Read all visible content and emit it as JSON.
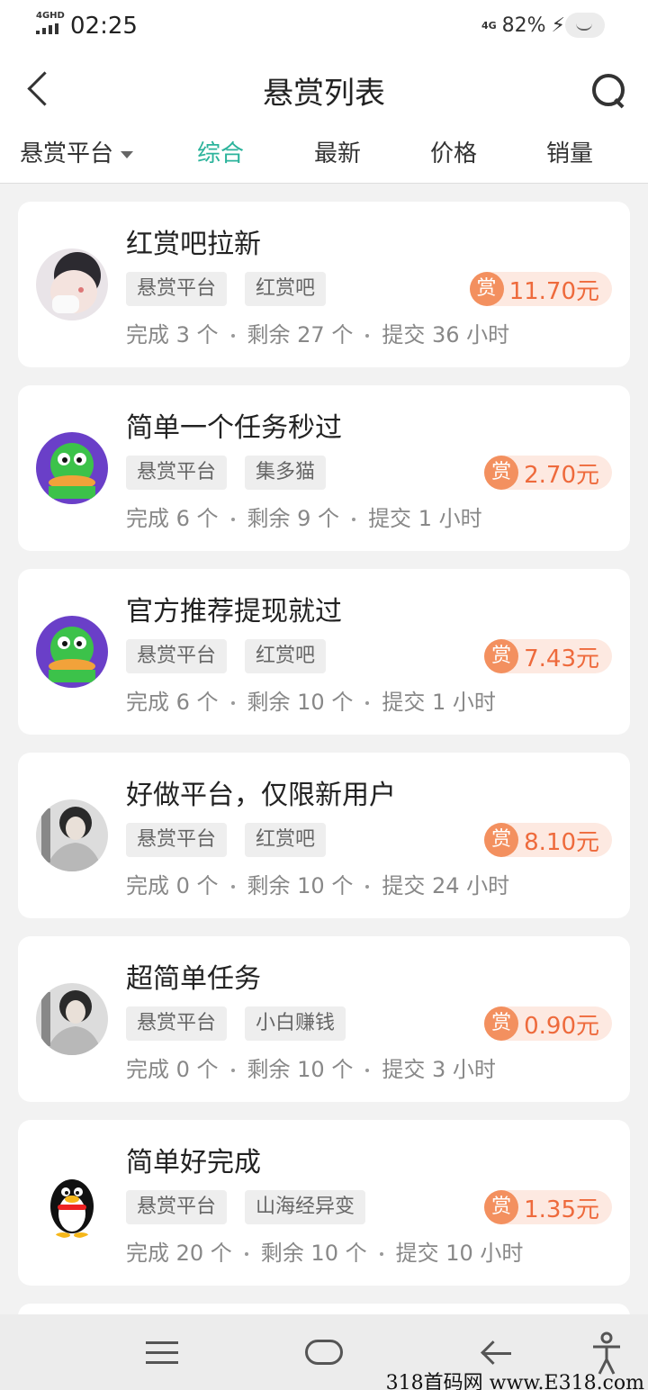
{
  "status_bar": {
    "network": "4GHD",
    "time": "02:25",
    "mobile_data": "4G",
    "battery": "82%"
  },
  "header": {
    "title": "悬赏列表",
    "icons": [
      "back-arrow-icon",
      "search-icon"
    ]
  },
  "filter_tabs": {
    "dropdown_label": "悬赏平台",
    "tabs": [
      "综合",
      "最新",
      "价格",
      "销量"
    ],
    "active_tab": "综合",
    "active_color": "#2bb39b"
  },
  "accent": {
    "reward_badge": "#f3905f",
    "reward_text": "#ee6a3c",
    "reward_bg": "#fde9e1"
  },
  "tasks": [
    {
      "title": "红赏吧拉新",
      "tags": [
        "悬赏平台",
        "红赏吧"
      ],
      "reward_badge": "赏",
      "price": "11.70元",
      "completed": "完成 3 个",
      "remaining": "剩余 27 个",
      "submit": "提交 36 小时",
      "avatar": "girl-photo"
    },
    {
      "title": "简单一个任务秒过",
      "tags": [
        "悬赏平台",
        "集多猫"
      ],
      "reward_badge": "赏",
      "price": "2.70元",
      "completed": "完成 6 个",
      "remaining": "剩余 9 个",
      "submit": "提交 1 小时",
      "avatar": "green-duck"
    },
    {
      "title": "官方推荐提现就过",
      "tags": [
        "悬赏平台",
        "红赏吧"
      ],
      "reward_badge": "赏",
      "price": "7.43元",
      "completed": "完成 6 个",
      "remaining": "剩余 10 个",
      "submit": "提交 1 小时",
      "avatar": "green-duck"
    },
    {
      "title": "好做平台，仅限新用户",
      "tags": [
        "悬赏平台",
        "红赏吧"
      ],
      "reward_badge": "赏",
      "price": "8.10元",
      "completed": "完成 0 个",
      "remaining": "剩余 10 个",
      "submit": "提交 24 小时",
      "avatar": "man-photo"
    },
    {
      "title": "超简单任务",
      "tags": [
        "悬赏平台",
        "小白赚钱"
      ],
      "reward_badge": "赏",
      "price": "0.90元",
      "completed": "完成 0 个",
      "remaining": "剩余 10 个",
      "submit": "提交 3 小时",
      "avatar": "man-photo"
    },
    {
      "title": "简单好完成",
      "tags": [
        "悬赏平台",
        "山海经异变"
      ],
      "reward_badge": "赏",
      "price": "1.35元",
      "completed": "完成 20 个",
      "remaining": "剩余 10 个",
      "submit": "提交 10 小时",
      "avatar": "qq-penguin"
    }
  ],
  "nav_bar": {
    "icons": [
      "menu-icon",
      "home-icon",
      "back-icon",
      "accessibility-icon"
    ]
  },
  "watermark": "318首码网 www.E318.com"
}
